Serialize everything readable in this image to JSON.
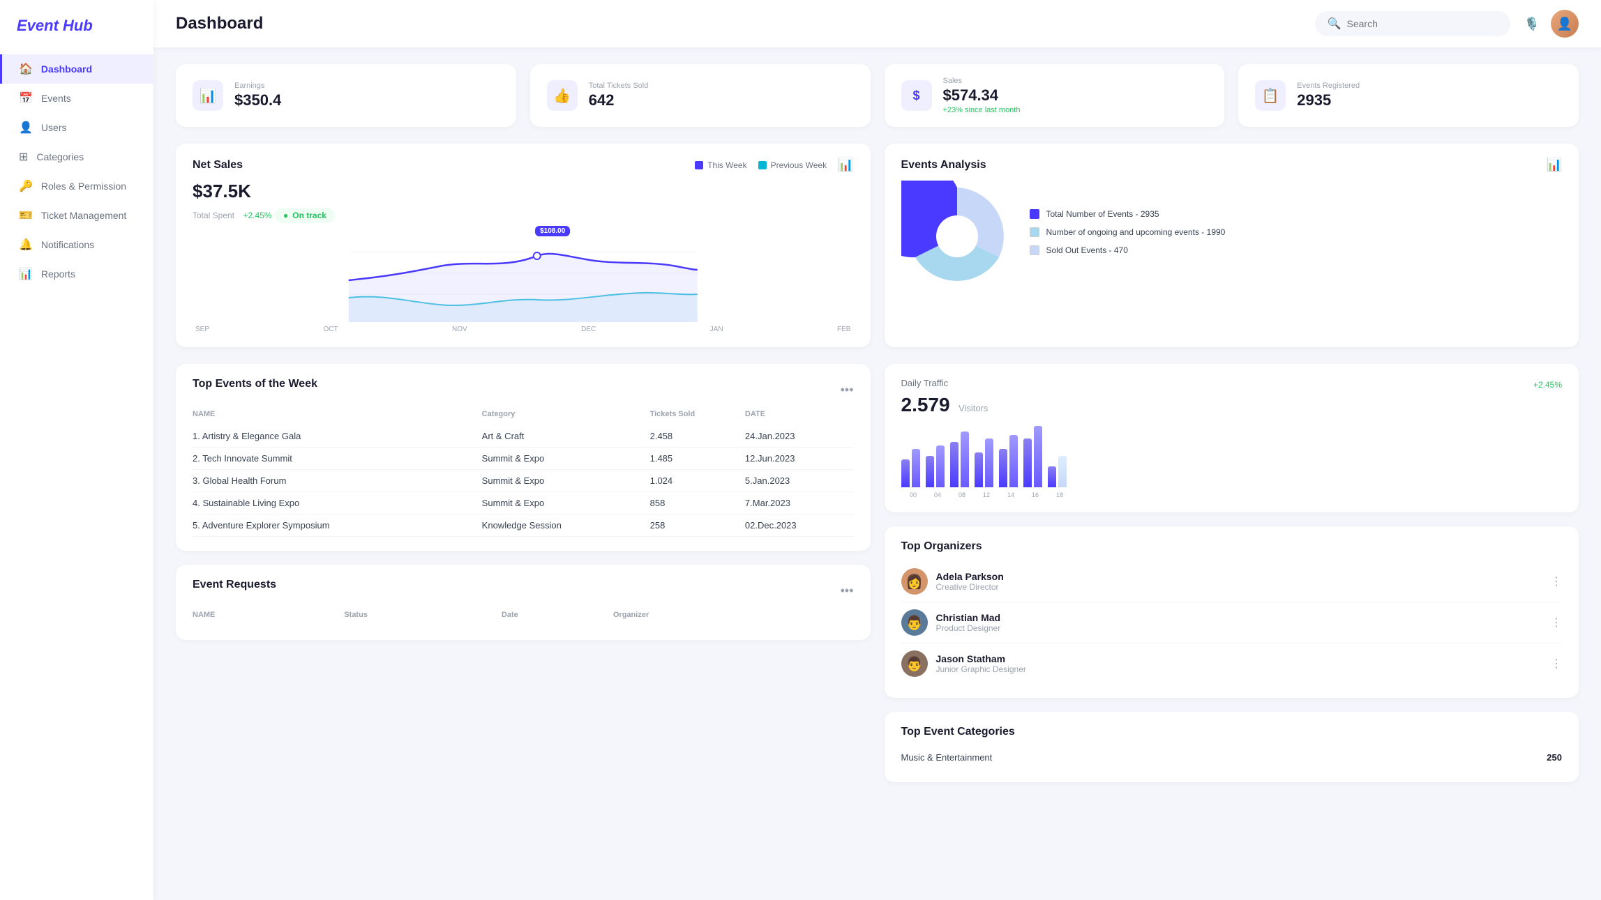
{
  "app": {
    "name": "Event Hub"
  },
  "sidebar": {
    "items": [
      {
        "id": "dashboard",
        "label": "Dashboard",
        "icon": "🏠",
        "active": true
      },
      {
        "id": "events",
        "label": "Events",
        "icon": "📅",
        "active": false
      },
      {
        "id": "users",
        "label": "Users",
        "icon": "👤",
        "active": false
      },
      {
        "id": "categories",
        "label": "Categories",
        "icon": "⊞",
        "active": false
      },
      {
        "id": "roles",
        "label": "Roles & Permission",
        "icon": "🔑",
        "active": false
      },
      {
        "id": "tickets",
        "label": "Ticket Management",
        "icon": "🎫",
        "active": false
      },
      {
        "id": "notifications",
        "label": "Notifications",
        "icon": "🔔",
        "active": false
      },
      {
        "id": "reports",
        "label": "Reports",
        "icon": "📊",
        "active": false
      }
    ]
  },
  "header": {
    "title": "Dashboard",
    "search_placeholder": "Search"
  },
  "stats": [
    {
      "id": "earnings",
      "label": "Earnings",
      "value": "$350.4",
      "icon": "📊",
      "sub": ""
    },
    {
      "id": "tickets_sold",
      "label": "Total Tickets Sold",
      "value": "642",
      "icon": "👍",
      "sub": ""
    },
    {
      "id": "sales",
      "label": "Sales",
      "value": "$574.34",
      "icon": "$",
      "sub": "+23% since last month"
    },
    {
      "id": "events_registered",
      "label": "Events Registered",
      "value": "2935",
      "icon": "📋",
      "sub": ""
    }
  ],
  "net_sales": {
    "title": "Net Sales",
    "value": "$37.5K",
    "sub": "Total Spent",
    "trend": "+2.45%",
    "status": "On track",
    "this_week_label": "This Week",
    "previous_week_label": "Previous Week",
    "x_labels": [
      "SEP",
      "OCT",
      "NOV",
      "DEC",
      "JAN",
      "FEB"
    ],
    "tooltip": "$108.00"
  },
  "events_analysis": {
    "title": "Events Analysis",
    "legend": [
      {
        "label": "Total Number of Events - 2935",
        "color": "#4a3aff"
      },
      {
        "label": "Number of ongoing and upcoming events - 1990",
        "color": "#c7e5f7"
      },
      {
        "label": "Sold Out Events - 470",
        "color": "#c7d7f7"
      }
    ],
    "pie": {
      "total": 2935,
      "ongoing": 1990,
      "sold_out": 470
    }
  },
  "top_events": {
    "title": "Top Events of the Week",
    "columns": [
      "NAME",
      "Category",
      "Tickets Sold",
      "DATE"
    ],
    "rows": [
      {
        "rank": "1.",
        "name": "Artistry & Elegance Gala",
        "category": "Art & Craft",
        "tickets": "2.458",
        "date": "24.Jan.2023"
      },
      {
        "rank": "2.",
        "name": "Tech Innovate Summit",
        "category": "Summit & Expo",
        "tickets": "1.485",
        "date": "12.Jun.2023"
      },
      {
        "rank": "3.",
        "name": "Global Health Forum",
        "category": "Summit & Expo",
        "tickets": "1.024",
        "date": "5.Jan.2023"
      },
      {
        "rank": "4.",
        "name": "Sustainable Living Expo",
        "category": "Summit & Expo",
        "tickets": "858",
        "date": "7.Mar.2023"
      },
      {
        "rank": "5.",
        "name": "Adventure Explorer Symposium",
        "category": "Knowledge Session",
        "tickets": "258",
        "date": "02.Dec.2023"
      }
    ]
  },
  "daily_traffic": {
    "title": "Daily Traffic",
    "value": "2.579",
    "visitors_label": "Visitors",
    "trend": "+2.45%",
    "x_labels": [
      "00",
      "04",
      "08",
      "12",
      "14",
      "16",
      "18"
    ],
    "bars": [
      {
        "label": "00",
        "h1": 40,
        "h2": 55
      },
      {
        "label": "04",
        "h1": 45,
        "h2": 60
      },
      {
        "label": "08",
        "h1": 65,
        "h2": 80
      },
      {
        "label": "12",
        "h1": 50,
        "h2": 70
      },
      {
        "label": "14",
        "h1": 55,
        "h2": 75
      },
      {
        "label": "16",
        "h1": 70,
        "h2": 90
      },
      {
        "label": "18",
        "h1": 30,
        "h2": 45
      }
    ]
  },
  "top_organizers": {
    "title": "Top Organizers",
    "items": [
      {
        "name": "Adela Parkson",
        "role": "Creative Director",
        "avatar_color": "#d4956a"
      },
      {
        "name": "Christian Mad",
        "role": "Product Designer",
        "avatar_color": "#5a7a9a"
      },
      {
        "name": "Jason Statham",
        "role": "Junior Graphic Designer",
        "avatar_color": "#8a7060"
      }
    ]
  },
  "event_requests": {
    "title": "Event Requests",
    "columns": [
      "NAME",
      "Status",
      "Date",
      "Organizer"
    ]
  },
  "top_categories": {
    "title": "Top Event Categories",
    "items": [
      {
        "name": "Music & Entertainment",
        "count": 250
      }
    ]
  }
}
